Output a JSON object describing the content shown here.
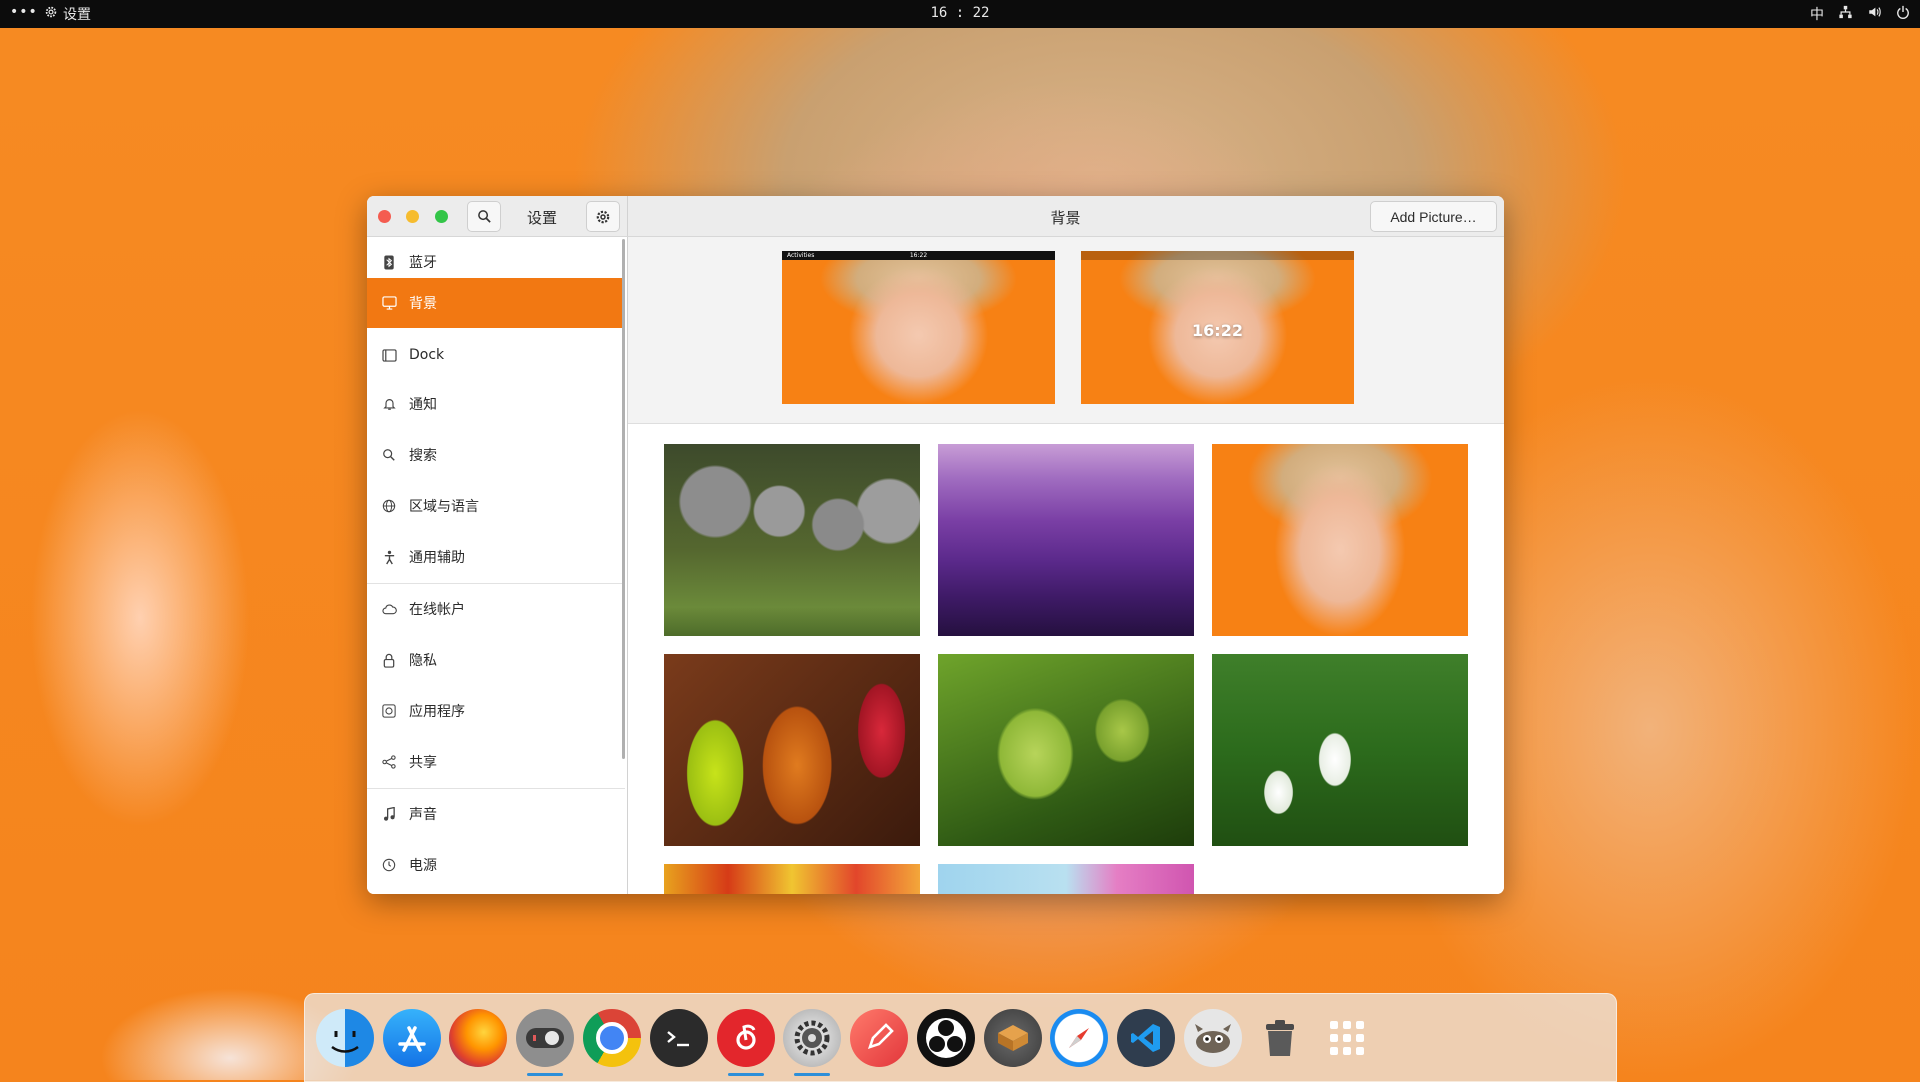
{
  "topbar": {
    "menu_dots": "•••",
    "app_name": "设置",
    "clock": "16 : 22",
    "input_method": "中",
    "icons": [
      "network-icon",
      "volume-icon",
      "power-icon"
    ]
  },
  "window": {
    "sidebar_title": "设置",
    "main_title": "背景",
    "add_picture_label": "Add Picture…"
  },
  "sidebar": {
    "items": [
      {
        "label": "蓝牙",
        "icon": "bluetooth-icon"
      },
      {
        "label": "背景",
        "icon": "monitor-icon",
        "active": true
      },
      {
        "label": "Dock",
        "icon": "dock-icon"
      },
      {
        "label": "通知",
        "icon": "bell-icon"
      },
      {
        "label": "搜索",
        "icon": "search-icon"
      },
      {
        "label": "区域与语言",
        "icon": "globe-icon"
      },
      {
        "label": "通用辅助",
        "icon": "accessibility-icon"
      },
      {
        "label": "在线帐户",
        "icon": "cloud-icon"
      },
      {
        "label": "隐私",
        "icon": "lock-icon"
      },
      {
        "label": "应用程序",
        "icon": "apps-icon"
      },
      {
        "label": "共享",
        "icon": "share-icon"
      },
      {
        "label": "声音",
        "icon": "music-note-icon"
      },
      {
        "label": "电源",
        "icon": "power-icon"
      }
    ]
  },
  "previews": {
    "desktop_bar_left": "Activities",
    "desktop_bar_clock": "16:22",
    "lock_clock": "16:22"
  },
  "wallpapers": [
    "koala",
    "purple-mountains",
    "portrait",
    "drinks",
    "grapes",
    "snowdrops",
    "candy",
    "pink-flower"
  ],
  "dock": {
    "apps": [
      "finder",
      "app-store",
      "firefox",
      "tweaks",
      "chrome",
      "terminal",
      "netease-music",
      "settings",
      "pencil",
      "obs",
      "package",
      "safari",
      "vscode",
      "gimp",
      "trash",
      "app-grid"
    ],
    "running": [
      "tweaks",
      "netease-music",
      "settings"
    ]
  },
  "colors": {
    "accent": "#f27812",
    "wallpaper": "#f5841d"
  }
}
